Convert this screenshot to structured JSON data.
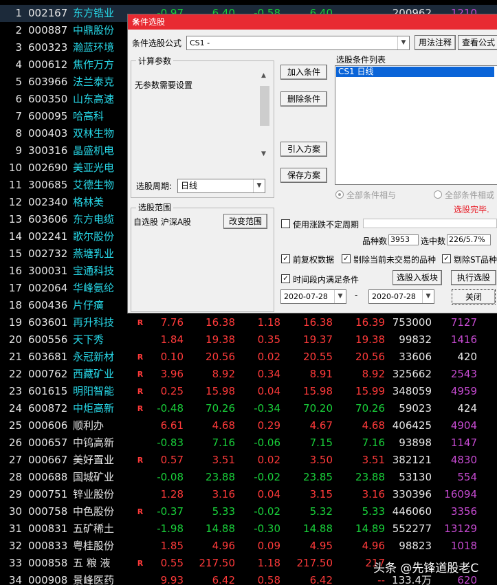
{
  "rows": [
    {
      "no": "1",
      "code": "002167",
      "name": "东方锆业",
      "flag": "",
      "v1": "-0.97",
      "v2": "6.40",
      "v3": "-0.58",
      "v4": "6.40",
      "v5": "",
      "v6": "200962",
      "v7": "1210",
      "v8": "",
      "dir": "dn",
      "cyan": true
    },
    {
      "no": "2",
      "code": "000887",
      "name": "中鼎股份",
      "cyan": true
    },
    {
      "no": "3",
      "code": "600323",
      "name": "瀚蓝环境",
      "cyan": true
    },
    {
      "no": "4",
      "code": "000612",
      "name": "焦作万方",
      "cyan": true
    },
    {
      "no": "5",
      "code": "603966",
      "name": "法兰泰克",
      "cyan": true
    },
    {
      "no": "6",
      "code": "600350",
      "name": "山东高速",
      "cyan": true
    },
    {
      "no": "7",
      "code": "600095",
      "name": "哈高科",
      "cyan": true
    },
    {
      "no": "8",
      "code": "000403",
      "name": "双林生物",
      "cyan": true
    },
    {
      "no": "9",
      "code": "300316",
      "name": "晶盛机电",
      "cyan": true
    },
    {
      "no": "10",
      "code": "002690",
      "name": "美亚光电",
      "cyan": true
    },
    {
      "no": "11",
      "code": "300685",
      "name": "艾德生物",
      "cyan": true
    },
    {
      "no": "12",
      "code": "002340",
      "name": "格林美",
      "cyan": true
    },
    {
      "no": "13",
      "code": "603606",
      "name": "东方电缆",
      "cyan": true
    },
    {
      "no": "14",
      "code": "002241",
      "name": "歌尔股份",
      "cyan": true
    },
    {
      "no": "15",
      "code": "002732",
      "name": "燕塘乳业",
      "cyan": true
    },
    {
      "no": "16",
      "code": "300031",
      "name": "宝通科技",
      "cyan": true
    },
    {
      "no": "17",
      "code": "002064",
      "name": "华峰氨纶",
      "cyan": true
    },
    {
      "no": "18",
      "code": "600436",
      "name": "片仔癀",
      "cyan": true
    },
    {
      "no": "19",
      "code": "603601",
      "name": "再升科技",
      "flag": "R",
      "v1": "7.76",
      "v2": "16.38",
      "v3": "1.18",
      "v4": "16.38",
      "v5": "16.39",
      "v6": "753000",
      "v7": "7127",
      "v8": "-",
      "dir": "up",
      "cyan": true
    },
    {
      "no": "20",
      "code": "600556",
      "name": "天下秀",
      "flag": "",
      "v1": "1.84",
      "v2": "19.38",
      "v3": "0.35",
      "v4": "19.37",
      "v5": "19.38",
      "v6": "99832",
      "v7": "1416",
      "v8": "",
      "dir": "up",
      "cyan": true
    },
    {
      "no": "21",
      "code": "603681",
      "name": "永冠新材",
      "flag": "R",
      "v1": "0.10",
      "v2": "20.56",
      "v3": "0.02",
      "v4": "20.55",
      "v5": "20.56",
      "v6": "33606",
      "v7": "420",
      "v8": "-",
      "dir": "up",
      "cyan": true,
      "v7w": true
    },
    {
      "no": "22",
      "code": "000762",
      "name": "西藏矿业",
      "flag": "R",
      "v1": "3.96",
      "v2": "8.92",
      "v3": "0.34",
      "v4": "8.91",
      "v5": "8.92",
      "v6": "325662",
      "v7": "2543",
      "v8": "",
      "dir": "up",
      "cyan": true
    },
    {
      "no": "23",
      "code": "601615",
      "name": "明阳智能",
      "flag": "R",
      "v1": "0.25",
      "v2": "15.98",
      "v3": "0.04",
      "v4": "15.98",
      "v5": "15.99",
      "v6": "348059",
      "v7": "4959",
      "v8": "",
      "dir": "up",
      "cyan": true
    },
    {
      "no": "24",
      "code": "600872",
      "name": "中炬高新",
      "flag": "R",
      "v1": "-0.48",
      "v2": "70.26",
      "v3": "-0.34",
      "v4": "70.20",
      "v5": "70.26",
      "v6": "59023",
      "v7": "424",
      "v8": "-",
      "dir": "dn",
      "cyan": true,
      "v7w": true
    },
    {
      "no": "25",
      "code": "000606",
      "name": "顺利办",
      "flag": "",
      "v1": "6.61",
      "v2": "4.68",
      "v3": "0.29",
      "v4": "4.67",
      "v5": "4.68",
      "v6": "406425",
      "v7": "4904",
      "v8": "",
      "dir": "up",
      "cyan": false
    },
    {
      "no": "26",
      "code": "000657",
      "name": "中钨高新",
      "flag": "",
      "v1": "-0.83",
      "v2": "7.16",
      "v3": "-0.06",
      "v4": "7.15",
      "v5": "7.16",
      "v6": "93898",
      "v7": "1147",
      "v8": "",
      "dir": "dn",
      "cyan": false
    },
    {
      "no": "27",
      "code": "000667",
      "name": "美好置业",
      "flag": "R",
      "v1": "0.57",
      "v2": "3.51",
      "v3": "0.02",
      "v4": "3.50",
      "v5": "3.51",
      "v6": "382121",
      "v7": "4830",
      "v8": "",
      "dir": "up",
      "cyan": false
    },
    {
      "no": "28",
      "code": "000688",
      "name": "国城矿业",
      "flag": "",
      "v1": "-0.08",
      "v2": "23.88",
      "v3": "-0.02",
      "v4": "23.85",
      "v5": "23.88",
      "v6": "53130",
      "v7": "554",
      "v8": "",
      "dir": "dn",
      "cyan": false
    },
    {
      "no": "29",
      "code": "000751",
      "name": "锌业股份",
      "flag": "",
      "v1": "1.28",
      "v2": "3.16",
      "v3": "0.04",
      "v4": "3.15",
      "v5": "3.16",
      "v6": "330396",
      "v7": "16094",
      "v8": "",
      "dir": "up",
      "cyan": false
    },
    {
      "no": "30",
      "code": "000758",
      "name": "中色股份",
      "flag": "R",
      "v1": "-0.37",
      "v2": "5.33",
      "v3": "-0.02",
      "v4": "5.32",
      "v5": "5.33",
      "v6": "446060",
      "v7": "3356",
      "v8": "",
      "dir": "dn",
      "cyan": false
    },
    {
      "no": "31",
      "code": "000831",
      "name": "五矿稀土",
      "flag": "",
      "v1": "-1.98",
      "v2": "14.88",
      "v3": "-0.30",
      "v4": "14.88",
      "v5": "14.89",
      "v6": "552277",
      "v7": "13129",
      "v8": "",
      "dir": "dn",
      "cyan": false
    },
    {
      "no": "32",
      "code": "000833",
      "name": "粤桂股份",
      "flag": "",
      "v1": "1.85",
      "v2": "4.96",
      "v3": "0.09",
      "v4": "4.95",
      "v5": "4.96",
      "v6": "98823",
      "v7": "1018",
      "v8": "",
      "dir": "up",
      "cyan": false
    },
    {
      "no": "33",
      "code": "000858",
      "name": "五 粮 液",
      "flag": "R",
      "v1": "0.55",
      "v2": "217.50",
      "v3": "1.18",
      "v4": "217.50",
      "v5": "217",
      "v6": "",
      "v7": "",
      "v8": "",
      "dir": "up",
      "cyan": false
    },
    {
      "no": "34",
      "code": "000908",
      "name": "景峰医药",
      "flag": "",
      "v1": "9.93",
      "v2": "6.42",
      "v3": "0.58",
      "v4": "6.42",
      "v5": "--",
      "v6": "133.4万",
      "v7": "620",
      "v8": "",
      "dir": "up",
      "cyan": false
    }
  ],
  "dialog": {
    "title": "条件选股",
    "close": "×",
    "formula_label": "条件选股公式",
    "formula_value": "CS1                    -",
    "usage_button": "用法注释",
    "view_formula_button": "查看公式",
    "params_title": "计算参数",
    "params_text": "无参数需要设置",
    "period_label": "选股周期:",
    "period_value": "日线",
    "add_button": "加入条件",
    "delete_button": "删除条件",
    "import_button": "引入方案",
    "save_button": "保存方案",
    "list_title": "选股条件列表",
    "list_item": "CS1   日线",
    "radio_and": "全部条件相与",
    "radio_or": "全部条件相或",
    "status": "选股完毕.",
    "range_title": "选股范围",
    "range_text": "自选股 沪深A股",
    "change_range_button": "改变范围",
    "uncertain_period": "使用涨跌不定周期",
    "count_label": "品种数",
    "count_value": "3953",
    "selected_label": "选中数",
    "selected_value": "226/5.7%",
    "adjust_label": "前复权数据",
    "exclude_untraded": "剔除当前未交易的品种",
    "exclude_st": "剔除ST品种",
    "time_condition": "时间段内满足条件",
    "to_block_button": "选股入板块",
    "execute_button": "执行选股",
    "close_button": "关闭",
    "date_from": "2020-07-28",
    "date_sep": "-",
    "date_to": "2020-07-28",
    "check_mark": "✓"
  },
  "watermark": "头条 @先锋道股老C"
}
